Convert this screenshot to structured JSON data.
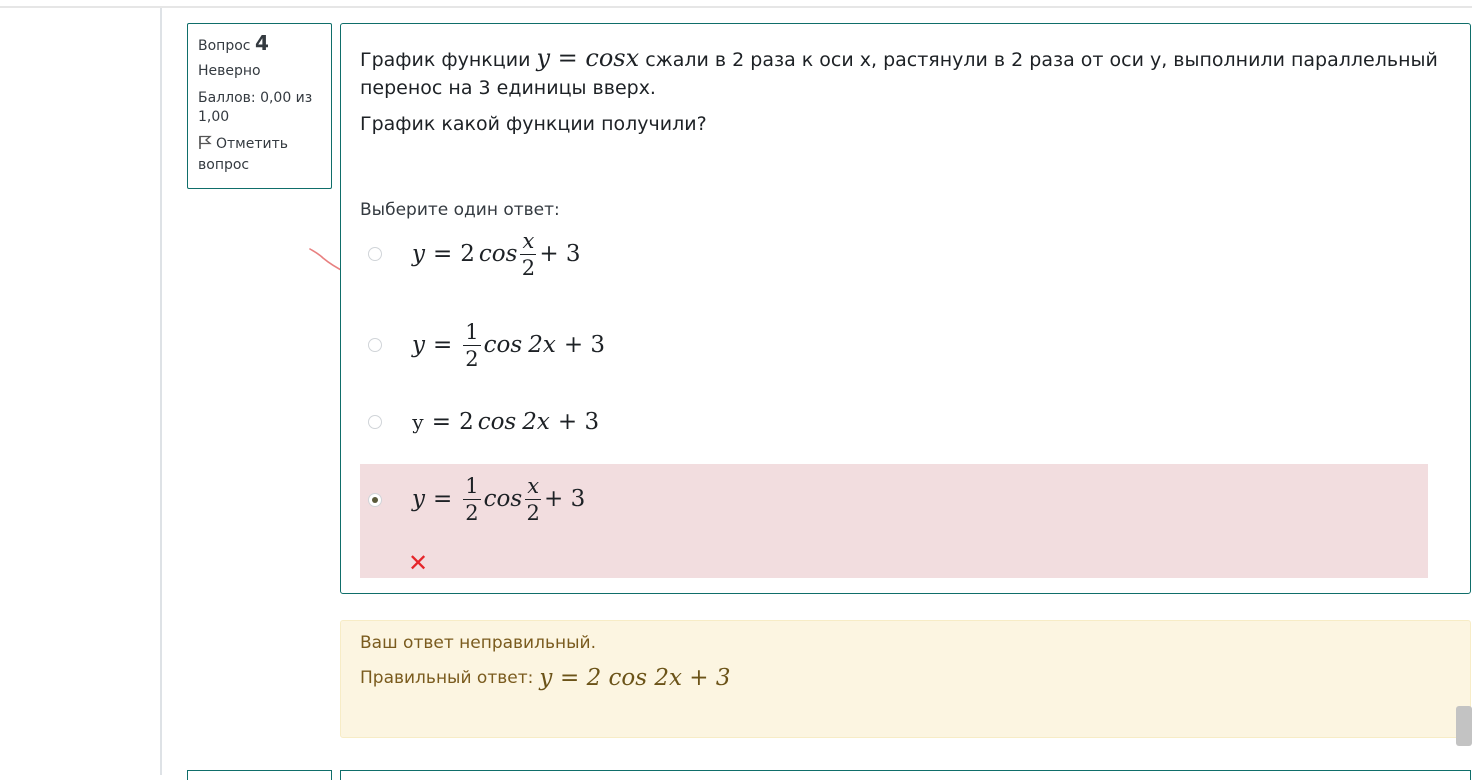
{
  "question_info": {
    "label": "Вопрос",
    "number": "4",
    "state": "Неверно",
    "grade": "Баллов: 0,00 из 1,00",
    "flag_label": "Отметить вопрос"
  },
  "question": {
    "text_prefix": "График функции",
    "inline_formula": "y = cosx",
    "text_suffix": "сжали в 2 раза к оси x, растянули в 2 раза от оси y, выполнили параллельный перенос на 3 единицы вверх.",
    "sub_question": "График какой функции получили?",
    "prompt": "Выберите один ответ:"
  },
  "answers": [
    {
      "lhs": "y",
      "coef": "2",
      "func": "cos",
      "arg_num": "x",
      "arg_den": "2",
      "tail": "+ 3",
      "selected": false
    },
    {
      "lhs": "y",
      "coef_num": "1",
      "coef_den": "2",
      "func": "cos",
      "arg": "2x",
      "tail": "+ 3",
      "selected": false
    },
    {
      "lhs": "у",
      "coef": "2",
      "func": "cos",
      "arg": "2x",
      "tail": "+ 3",
      "selected": false
    },
    {
      "lhs": "y",
      "coef_num": "1",
      "coef_den": "2",
      "func": "cos",
      "arg_num": "x",
      "arg_den": "2",
      "tail": "+ 3",
      "selected": true,
      "status": "incorrect"
    }
  ],
  "feedback": {
    "message": "Ваш ответ неправильный.",
    "correct_label": "Правильный ответ:",
    "correct_formula": "у = 2 cos 2x  + 3"
  },
  "colors": {
    "border": "#0f6e6a",
    "incorrect_bg": "#f2dddf",
    "feedback_bg": "#fcf5e1",
    "x_mark": "#e5262b"
  },
  "icons": {
    "flag": "flag-icon",
    "incorrect": "cross-icon",
    "annotation": "handwritten-check-icon"
  }
}
